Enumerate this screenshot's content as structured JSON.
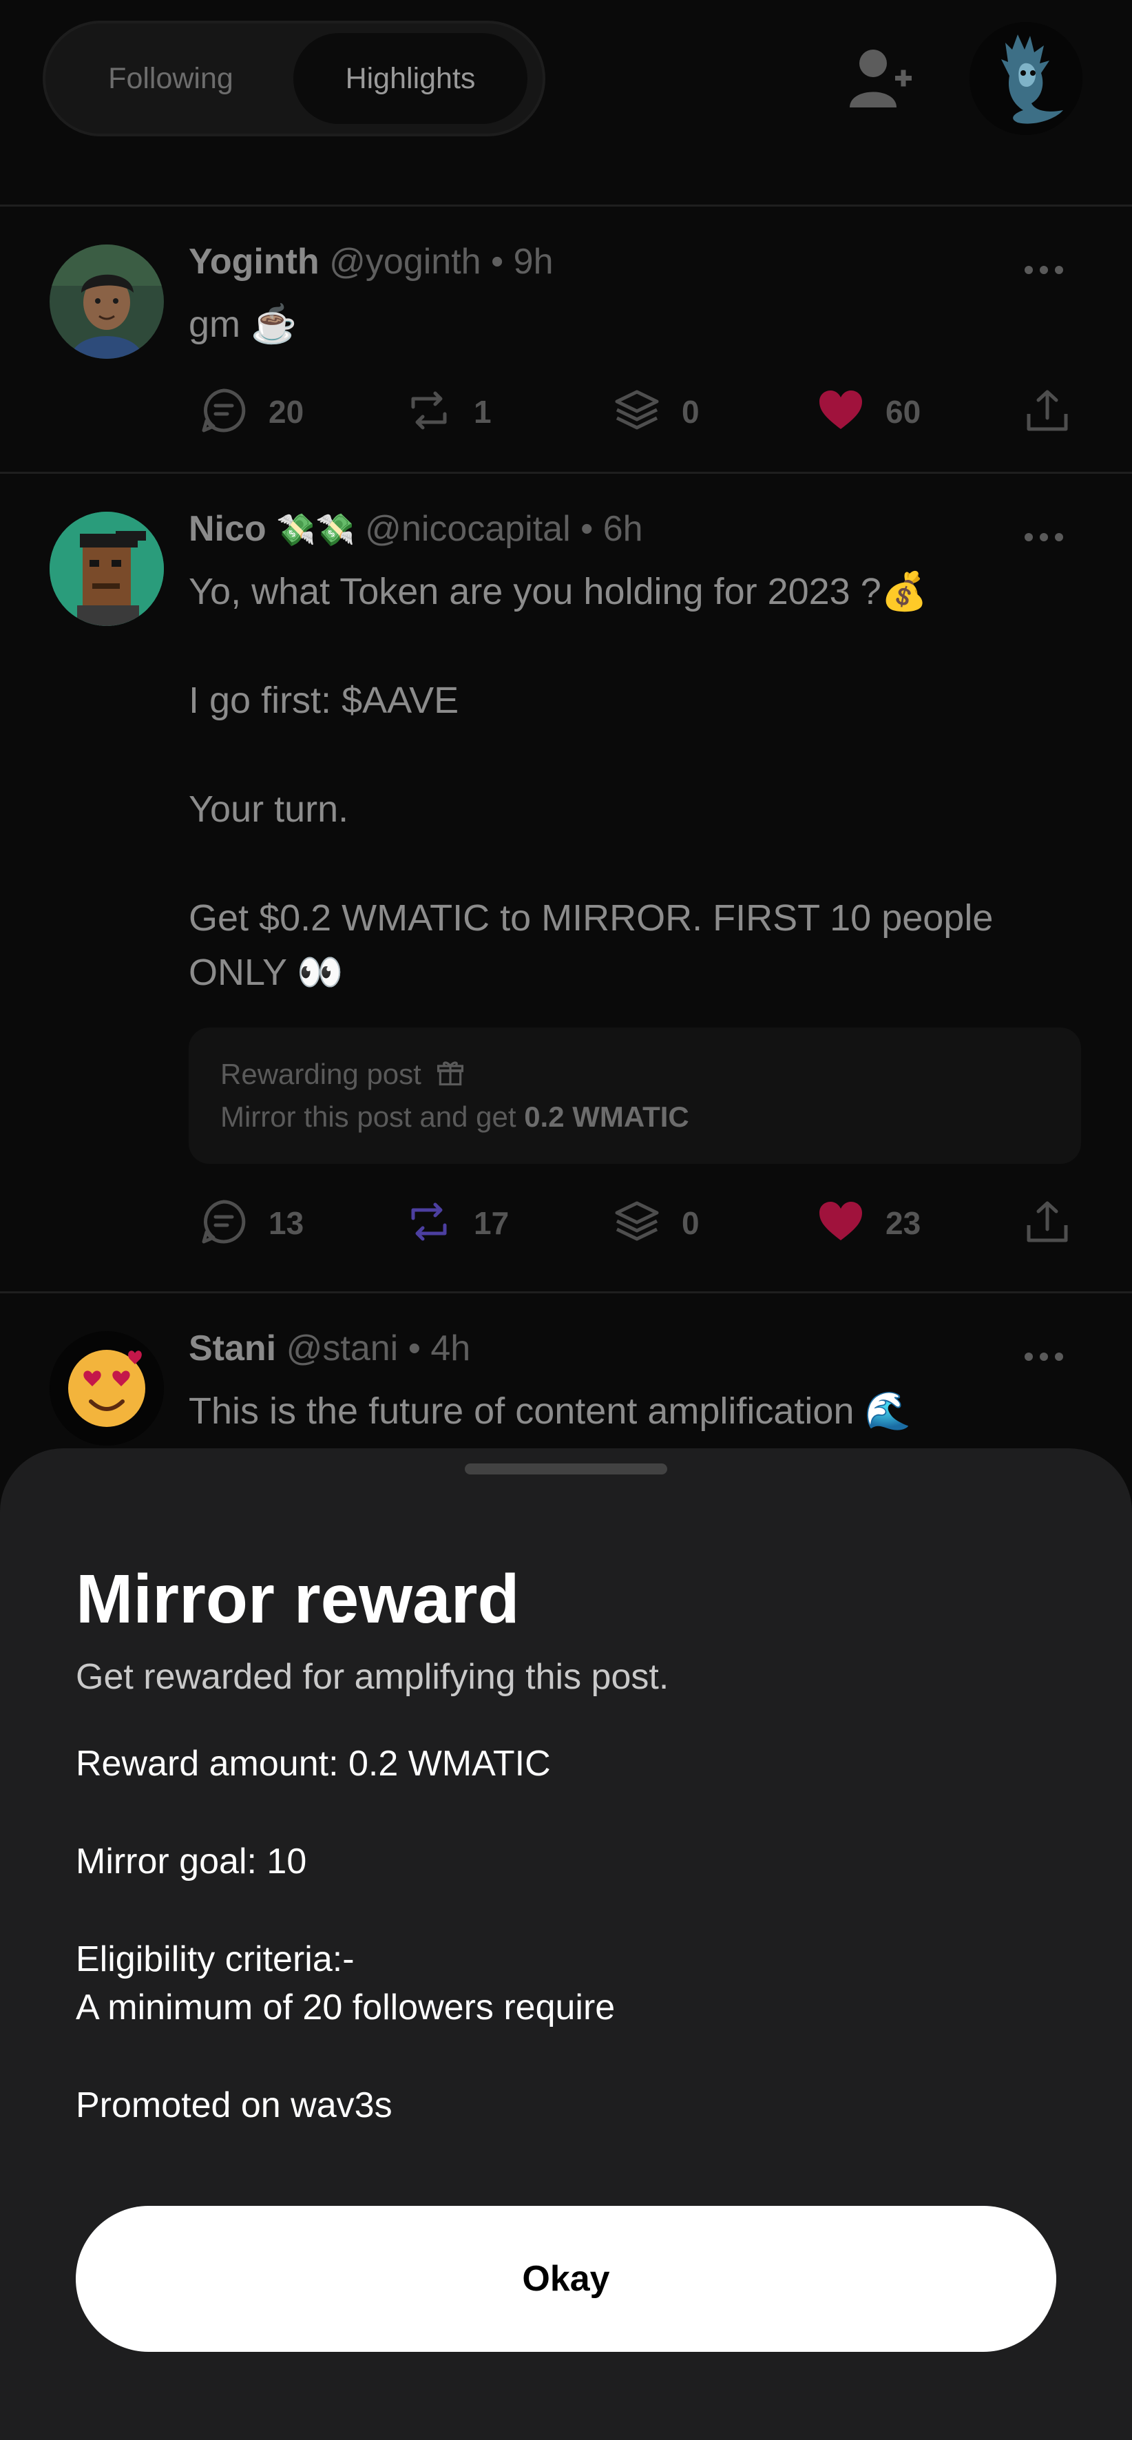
{
  "header": {
    "tabs": [
      {
        "label": "Following",
        "selected": false
      },
      {
        "label": "Highlights",
        "selected": true
      }
    ],
    "add_user_icon": "user-plus-icon",
    "profile_avatar_icon": "ghost-dragon-avatar"
  },
  "posts": [
    {
      "author": "Yoginth",
      "handle": "@yoginth",
      "time": "• 9h",
      "body": "gm ☕",
      "stats": {
        "comments": "20",
        "mirrors": "1",
        "collects": "0",
        "likes": "60"
      }
    },
    {
      "author": "Nico",
      "author_emoji": "💸💸",
      "handle": "@nicocapital",
      "time": "• 6h",
      "body": "Yo, what Token are you holding for 2023 ?💰\n\nI go first: $AAVE\n\nYour turn.\n\nGet $0.2 WMATIC to MIRROR. FIRST 10 people\nONLY 👀",
      "reward": {
        "title": "Rewarding post",
        "line_prefix": "Mirror this post and get ",
        "amount": "0.2 WMATIC"
      },
      "stats": {
        "comments": "13",
        "mirrors": "17",
        "collects": "0",
        "likes": "23"
      }
    },
    {
      "author": "Stani",
      "handle": "@stani",
      "time": "• 4h",
      "body": "This is the future of content amplification 🌊"
    }
  ],
  "sheet": {
    "title": "Mirror reward",
    "subtitle": "Get rewarded for amplifying this post.",
    "reward_amount": "Reward amount: 0.2 WMATIC",
    "mirror_goal": "Mirror goal: 10",
    "eligibility_title": "Eligibility criteria:-",
    "eligibility_rule": "A minimum of 20 followers require",
    "promoted": "Promoted on wav3s",
    "ok_label": "Okay"
  },
  "colors": {
    "like": "#a0123c",
    "mirror_active": "#4c3fa0",
    "sheet_bg": "#1e1e1f",
    "background": "#0a0a0a"
  }
}
